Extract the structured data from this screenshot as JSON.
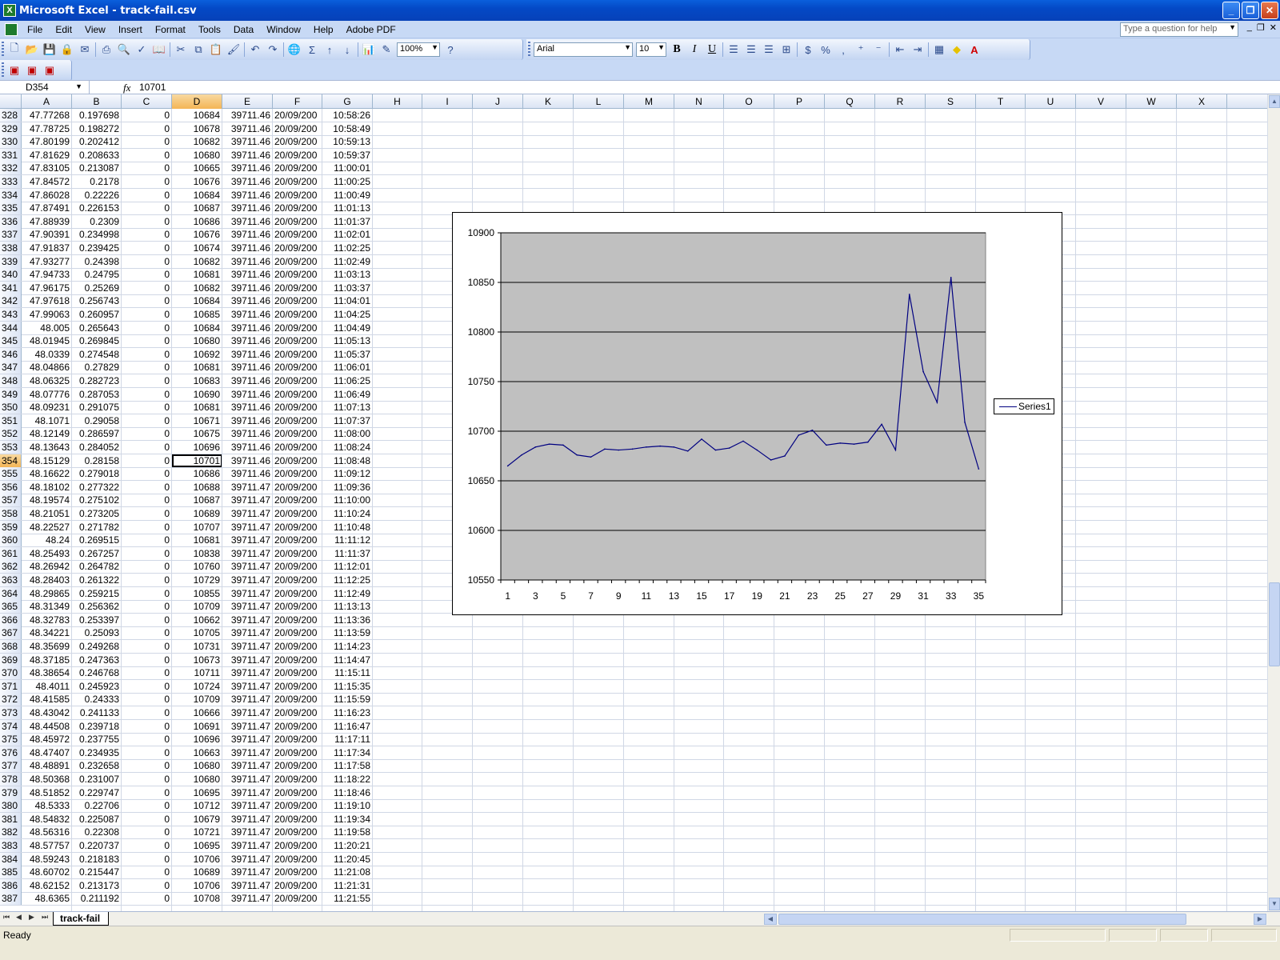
{
  "window": {
    "title": "Microsoft Excel - track-fail.csv"
  },
  "menu": [
    "File",
    "Edit",
    "View",
    "Insert",
    "Format",
    "Tools",
    "Data",
    "Window",
    "Help",
    "Adobe PDF"
  ],
  "help_box": {
    "placeholder": "Type a question for help"
  },
  "toolbar": {
    "zoom": "100%",
    "font_name": "Arial",
    "font_size": "10",
    "bold": "B",
    "italic": "I",
    "underline": "U",
    "sum": "Σ",
    "percent": "%",
    "comma": ","
  },
  "formula_bar": {
    "name_box": "D354",
    "fx": "fx",
    "value": "10701"
  },
  "columns": [
    "A",
    "B",
    "C",
    "D",
    "E",
    "F",
    "G",
    "H",
    "I",
    "J",
    "K",
    "L",
    "M",
    "N",
    "O",
    "P",
    "Q",
    "R",
    "S",
    "T",
    "U",
    "V",
    "W",
    "X"
  ],
  "active_column": "D",
  "active_row": "354",
  "rows": [
    [
      "328",
      "47.77268",
      "0.197698",
      "0",
      "10684",
      "39711.46",
      "20/09/200",
      "10:58:26"
    ],
    [
      "329",
      "47.78725",
      "0.198272",
      "0",
      "10678",
      "39711.46",
      "20/09/200",
      "10:58:49"
    ],
    [
      "330",
      "47.80199",
      "0.202412",
      "0",
      "10682",
      "39711.46",
      "20/09/200",
      "10:59:13"
    ],
    [
      "331",
      "47.81629",
      "0.208633",
      "0",
      "10680",
      "39711.46",
      "20/09/200",
      "10:59:37"
    ],
    [
      "332",
      "47.83105",
      "0.213087",
      "0",
      "10665",
      "39711.46",
      "20/09/200",
      "11:00:01"
    ],
    [
      "333",
      "47.84572",
      "0.2178",
      "0",
      "10676",
      "39711.46",
      "20/09/200",
      "11:00:25"
    ],
    [
      "334",
      "47.86028",
      "0.22226",
      "0",
      "10684",
      "39711.46",
      "20/09/200",
      "11:00:49"
    ],
    [
      "335",
      "47.87491",
      "0.226153",
      "0",
      "10687",
      "39711.46",
      "20/09/200",
      "11:01:13"
    ],
    [
      "336",
      "47.88939",
      "0.2309",
      "0",
      "10686",
      "39711.46",
      "20/09/200",
      "11:01:37"
    ],
    [
      "337",
      "47.90391",
      "0.234998",
      "0",
      "10676",
      "39711.46",
      "20/09/200",
      "11:02:01"
    ],
    [
      "338",
      "47.91837",
      "0.239425",
      "0",
      "10674",
      "39711.46",
      "20/09/200",
      "11:02:25"
    ],
    [
      "339",
      "47.93277",
      "0.24398",
      "0",
      "10682",
      "39711.46",
      "20/09/200",
      "11:02:49"
    ],
    [
      "340",
      "47.94733",
      "0.24795",
      "0",
      "10681",
      "39711.46",
      "20/09/200",
      "11:03:13"
    ],
    [
      "341",
      "47.96175",
      "0.25269",
      "0",
      "10682",
      "39711.46",
      "20/09/200",
      "11:03:37"
    ],
    [
      "342",
      "47.97618",
      "0.256743",
      "0",
      "10684",
      "39711.46",
      "20/09/200",
      "11:04:01"
    ],
    [
      "343",
      "47.99063",
      "0.260957",
      "0",
      "10685",
      "39711.46",
      "20/09/200",
      "11:04:25"
    ],
    [
      "344",
      "48.005",
      "0.265643",
      "0",
      "10684",
      "39711.46",
      "20/09/200",
      "11:04:49"
    ],
    [
      "345",
      "48.01945",
      "0.269845",
      "0",
      "10680",
      "39711.46",
      "20/09/200",
      "11:05:13"
    ],
    [
      "346",
      "48.0339",
      "0.274548",
      "0",
      "10692",
      "39711.46",
      "20/09/200",
      "11:05:37"
    ],
    [
      "347",
      "48.04866",
      "0.27829",
      "0",
      "10681",
      "39711.46",
      "20/09/200",
      "11:06:01"
    ],
    [
      "348",
      "48.06325",
      "0.282723",
      "0",
      "10683",
      "39711.46",
      "20/09/200",
      "11:06:25"
    ],
    [
      "349",
      "48.07776",
      "0.287053",
      "0",
      "10690",
      "39711.46",
      "20/09/200",
      "11:06:49"
    ],
    [
      "350",
      "48.09231",
      "0.291075",
      "0",
      "10681",
      "39711.46",
      "20/09/200",
      "11:07:13"
    ],
    [
      "351",
      "48.1071",
      "0.29058",
      "0",
      "10671",
      "39711.46",
      "20/09/200",
      "11:07:37"
    ],
    [
      "352",
      "48.12149",
      "0.286597",
      "0",
      "10675",
      "39711.46",
      "20/09/200",
      "11:08:00"
    ],
    [
      "353",
      "48.13643",
      "0.284052",
      "0",
      "10696",
      "39711.46",
      "20/09/200",
      "11:08:24"
    ],
    [
      "354",
      "48.15129",
      "0.28158",
      "0",
      "10701",
      "39711.46",
      "20/09/200",
      "11:08:48"
    ],
    [
      "355",
      "48.16622",
      "0.279018",
      "0",
      "10686",
      "39711.46",
      "20/09/200",
      "11:09:12"
    ],
    [
      "356",
      "48.18102",
      "0.277322",
      "0",
      "10688",
      "39711.47",
      "20/09/200",
      "11:09:36"
    ],
    [
      "357",
      "48.19574",
      "0.275102",
      "0",
      "10687",
      "39711.47",
      "20/09/200",
      "11:10:00"
    ],
    [
      "358",
      "48.21051",
      "0.273205",
      "0",
      "10689",
      "39711.47",
      "20/09/200",
      "11:10:24"
    ],
    [
      "359",
      "48.22527",
      "0.271782",
      "0",
      "10707",
      "39711.47",
      "20/09/200",
      "11:10:48"
    ],
    [
      "360",
      "48.24",
      "0.269515",
      "0",
      "10681",
      "39711.47",
      "20/09/200",
      "11:11:12"
    ],
    [
      "361",
      "48.25493",
      "0.267257",
      "0",
      "10838",
      "39711.47",
      "20/09/200",
      "11:11:37"
    ],
    [
      "362",
      "48.26942",
      "0.264782",
      "0",
      "10760",
      "39711.47",
      "20/09/200",
      "11:12:01"
    ],
    [
      "363",
      "48.28403",
      "0.261322",
      "0",
      "10729",
      "39711.47",
      "20/09/200",
      "11:12:25"
    ],
    [
      "364",
      "48.29865",
      "0.259215",
      "0",
      "10855",
      "39711.47",
      "20/09/200",
      "11:12:49"
    ],
    [
      "365",
      "48.31349",
      "0.256362",
      "0",
      "10709",
      "39711.47",
      "20/09/200",
      "11:13:13"
    ],
    [
      "366",
      "48.32783",
      "0.253397",
      "0",
      "10662",
      "39711.47",
      "20/09/200",
      "11:13:36"
    ],
    [
      "367",
      "48.34221",
      "0.25093",
      "0",
      "10705",
      "39711.47",
      "20/09/200",
      "11:13:59"
    ],
    [
      "368",
      "48.35699",
      "0.249268",
      "0",
      "10731",
      "39711.47",
      "20/09/200",
      "11:14:23"
    ],
    [
      "369",
      "48.37185",
      "0.247363",
      "0",
      "10673",
      "39711.47",
      "20/09/200",
      "11:14:47"
    ],
    [
      "370",
      "48.38654",
      "0.246768",
      "0",
      "10711",
      "39711.47",
      "20/09/200",
      "11:15:11"
    ],
    [
      "371",
      "48.4011",
      "0.245923",
      "0",
      "10724",
      "39711.47",
      "20/09/200",
      "11:15:35"
    ],
    [
      "372",
      "48.41585",
      "0.24333",
      "0",
      "10709",
      "39711.47",
      "20/09/200",
      "11:15:59"
    ],
    [
      "373",
      "48.43042",
      "0.241133",
      "0",
      "10666",
      "39711.47",
      "20/09/200",
      "11:16:23"
    ],
    [
      "374",
      "48.44508",
      "0.239718",
      "0",
      "10691",
      "39711.47",
      "20/09/200",
      "11:16:47"
    ],
    [
      "375",
      "48.45972",
      "0.237755",
      "0",
      "10696",
      "39711.47",
      "20/09/200",
      "11:17:11"
    ],
    [
      "376",
      "48.47407",
      "0.234935",
      "0",
      "10663",
      "39711.47",
      "20/09/200",
      "11:17:34"
    ],
    [
      "377",
      "48.48891",
      "0.232658",
      "0",
      "10680",
      "39711.47",
      "20/09/200",
      "11:17:58"
    ],
    [
      "378",
      "48.50368",
      "0.231007",
      "0",
      "10680",
      "39711.47",
      "20/09/200",
      "11:18:22"
    ],
    [
      "379",
      "48.51852",
      "0.229747",
      "0",
      "10695",
      "39711.47",
      "20/09/200",
      "11:18:46"
    ],
    [
      "380",
      "48.5333",
      "0.22706",
      "0",
      "10712",
      "39711.47",
      "20/09/200",
      "11:19:10"
    ],
    [
      "381",
      "48.54832",
      "0.225087",
      "0",
      "10679",
      "39711.47",
      "20/09/200",
      "11:19:34"
    ],
    [
      "382",
      "48.56316",
      "0.22308",
      "0",
      "10721",
      "39711.47",
      "20/09/200",
      "11:19:58"
    ],
    [
      "383",
      "48.57757",
      "0.220737",
      "0",
      "10695",
      "39711.47",
      "20/09/200",
      "11:20:21"
    ],
    [
      "384",
      "48.59243",
      "0.218183",
      "0",
      "10706",
      "39711.47",
      "20/09/200",
      "11:20:45"
    ],
    [
      "385",
      "48.60702",
      "0.215447",
      "0",
      "10689",
      "39711.47",
      "20/09/200",
      "11:21:08"
    ],
    [
      "386",
      "48.62152",
      "0.213173",
      "0",
      "10706",
      "39711.47",
      "20/09/200",
      "11:21:31"
    ],
    [
      "387",
      "48.6365",
      "0.211192",
      "0",
      "10708",
      "39711.47",
      "20/09/200",
      "11:21:55"
    ]
  ],
  "sheet_tab": "track-fail",
  "status": "Ready",
  "colors": {
    "chart_plot_bg": "#c0c0c0",
    "series_line": "#000080",
    "active_header": "#f4b556"
  },
  "chart_data": {
    "type": "line",
    "x": [
      1,
      2,
      3,
      4,
      5,
      6,
      7,
      8,
      9,
      10,
      11,
      12,
      13,
      14,
      15,
      16,
      17,
      18,
      19,
      20,
      21,
      22,
      23,
      24,
      25,
      26,
      27,
      28,
      29,
      30,
      31,
      32,
      33,
      34,
      35
    ],
    "x_tick_labels": [
      "1",
      "3",
      "5",
      "7",
      "9",
      "11",
      "13",
      "15",
      "17",
      "19",
      "21",
      "23",
      "25",
      "27",
      "29",
      "31",
      "33",
      "35"
    ],
    "series": [
      {
        "name": "Series1",
        "values": [
          10665,
          10676,
          10684,
          10687,
          10686,
          10676,
          10674,
          10682,
          10681,
          10682,
          10684,
          10685,
          10684,
          10680,
          10692,
          10681,
          10683,
          10690,
          10681,
          10671,
          10675,
          10696,
          10701,
          10686,
          10688,
          10687,
          10689,
          10707,
          10681,
          10838,
          10760,
          10729,
          10855,
          10709,
          10662
        ]
      }
    ],
    "ylim": [
      10550,
      10900
    ],
    "y_ticks": [
      10550,
      10600,
      10650,
      10700,
      10750,
      10800,
      10850,
      10900
    ],
    "title": "",
    "xlabel": "",
    "ylabel": "",
    "grid": "horizontal major",
    "legend": "right"
  }
}
